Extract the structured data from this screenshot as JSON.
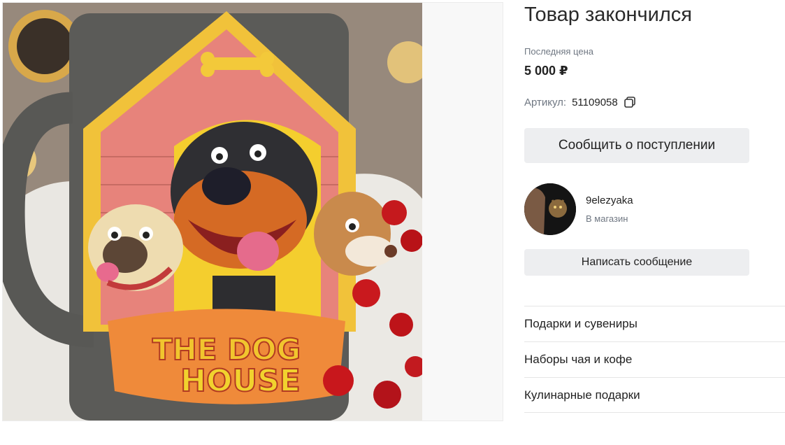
{
  "product": {
    "title": "Товар закончился",
    "last_price_label": "Последняя цена",
    "last_price": "5 000 ₽",
    "sku_label": "Артикул:",
    "sku_value": "51109058",
    "image_lettering": "THE DOG HOUSE"
  },
  "actions": {
    "notify_label": "Сообщить о поступлении",
    "message_label": "Написать сообщение"
  },
  "seller": {
    "name": "9elezyaka",
    "store_link": "В магазин"
  },
  "categories": [
    {
      "label": "Подарки и сувениры"
    },
    {
      "label": "Наборы чая и кофе"
    },
    {
      "label": "Кулинарные подарки"
    }
  ],
  "icons": {
    "copy": "copy-icon"
  }
}
